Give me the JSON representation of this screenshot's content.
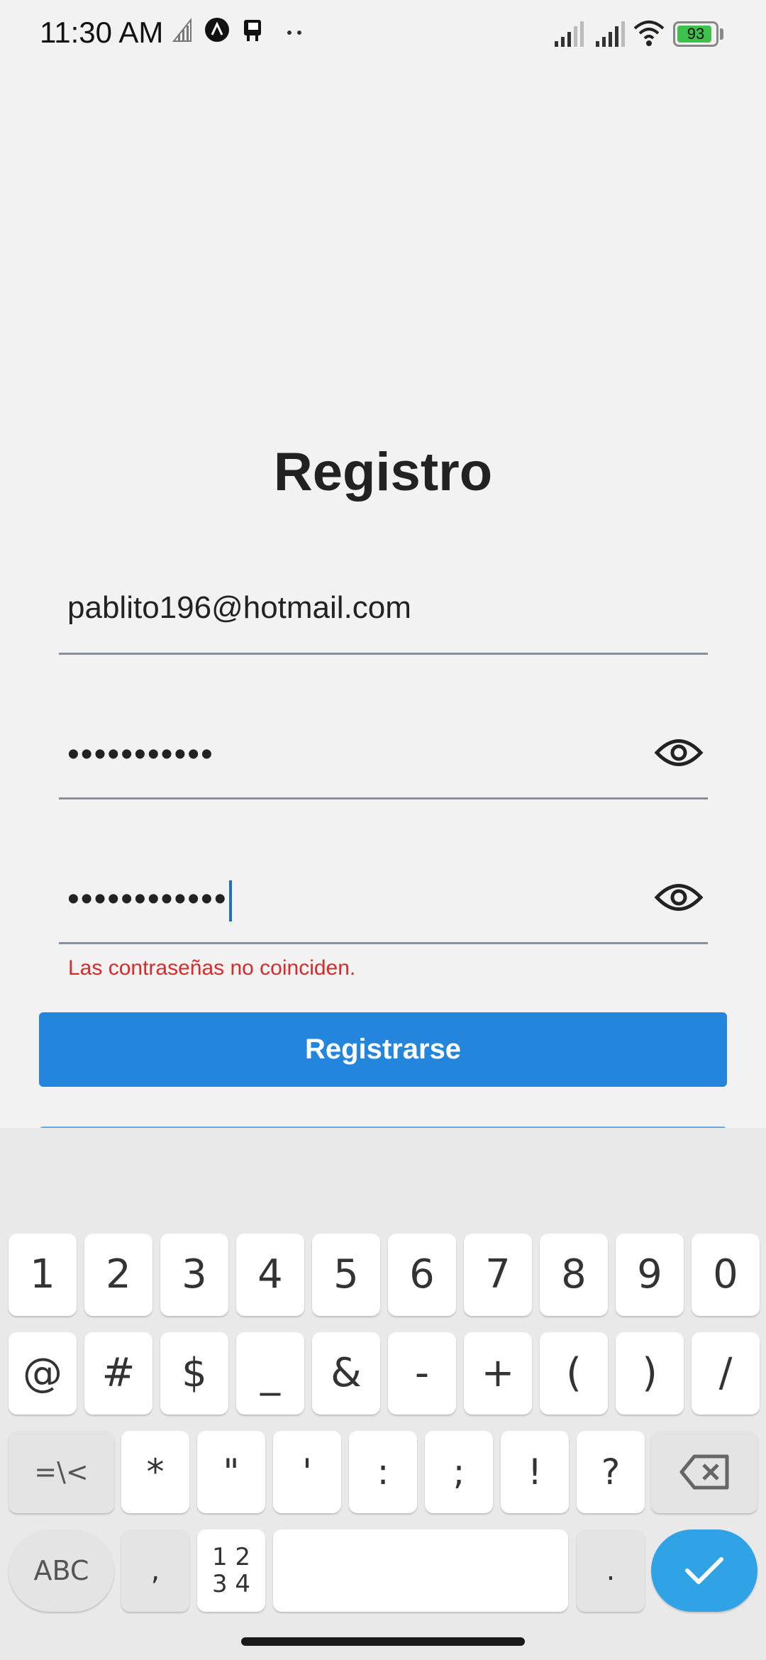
{
  "status_bar": {
    "time": "11:30 AM",
    "battery_level": "93",
    "battery_fraction": 0.93,
    "left_icons": [
      "signal-off-icon",
      "app-a-icon",
      "app-b-icon",
      "more-dots-icon"
    ],
    "right_icons": [
      "signal-icon",
      "signal-icon-2",
      "wifi-icon",
      "battery-icon"
    ]
  },
  "form": {
    "title": "Registro",
    "email_value": "pablito196@hotmail.com",
    "password_value": "•••••••••••",
    "confirm_password_value": "••••••••••••",
    "error_message": "Las contraseñas no coinciden.",
    "register_label": "Registrarse"
  },
  "keyboard": {
    "row1": [
      "1",
      "2",
      "3",
      "4",
      "5",
      "6",
      "7",
      "8",
      "9",
      "0"
    ],
    "row2": [
      "@",
      "#",
      "$",
      "_",
      "&",
      "-",
      "+",
      "(",
      ")",
      "/"
    ],
    "row3": [
      "=\\<",
      "*",
      "\"",
      "'",
      ":",
      ";",
      "!",
      "?"
    ],
    "abc_label": "ABC",
    "comma_label": ",",
    "num_top": "1 2",
    "num_bottom": "3 4",
    "period_label": ".",
    "colors": {
      "enter": "#2fa3e6",
      "key": "#ffffff",
      "mod_key": "#e4e4e4"
    }
  }
}
